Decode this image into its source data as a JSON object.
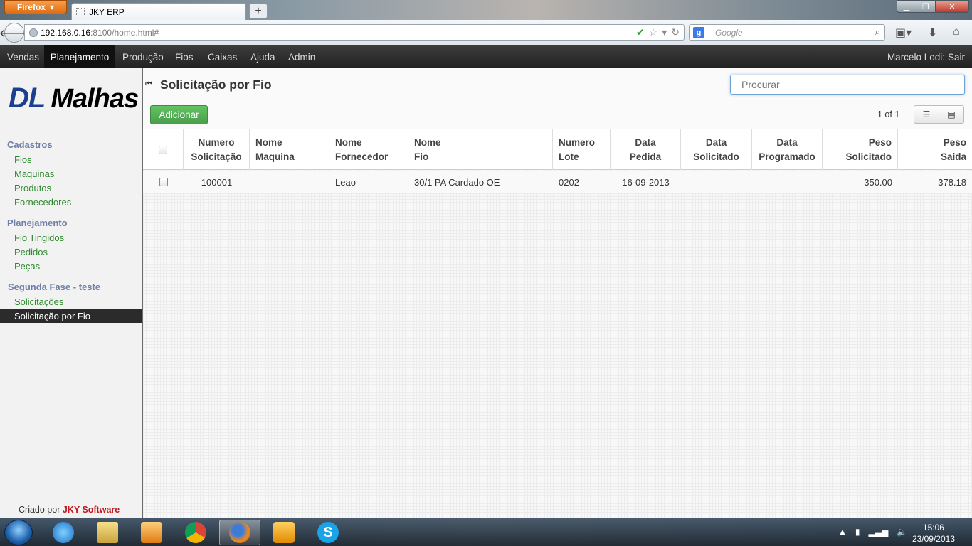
{
  "browser": {
    "menu_button": "Firefox",
    "tab_title": "JKY ERP",
    "url_host": "192.168.0.16",
    "url_rest": ":8100/home.html#",
    "search_placeholder": "Google"
  },
  "app": {
    "menus": [
      "Vendas",
      "Planejamento",
      "Produção",
      "Fios",
      "Caixas",
      "Ajuda",
      "Admin"
    ],
    "active_menu": "Planejamento",
    "user": "Marcelo Lodi:",
    "logout": "Sair"
  },
  "sidebar": {
    "logo_dl": "DL",
    "logo_name": "Malhas",
    "groups": [
      {
        "title": "Cadastros",
        "items": [
          "Fios",
          "Maquinas",
          "Produtos",
          "Fornecedores"
        ]
      },
      {
        "title": "Planejamento",
        "items": [
          "Fio Tingidos",
          "Pedidos",
          "Peças"
        ]
      },
      {
        "title": "Segunda Fase - teste",
        "items": [
          "Solicitações",
          "Solicitação por Fio"
        ]
      }
    ],
    "selected": "Solicitação por Fio",
    "credit_prefix": "Criado por",
    "credit_brand": "JKY Software"
  },
  "main": {
    "title": "Solicitação por Fio",
    "search_placeholder": "Procurar",
    "add_label": "Adicionar",
    "pager": "1 of 1",
    "columns": [
      {
        "l1": "Numero",
        "l2": "Solicitação"
      },
      {
        "l1": "Nome",
        "l2": "Maquina"
      },
      {
        "l1": "Nome",
        "l2": "Fornecedor"
      },
      {
        "l1": "Nome",
        "l2": "Fio"
      },
      {
        "l1": "Numero",
        "l2": "Lote"
      },
      {
        "l1": "Data",
        "l2": "Pedida"
      },
      {
        "l1": "Data",
        "l2": "Solicitado"
      },
      {
        "l1": "Data",
        "l2": "Programado"
      },
      {
        "l1": "Peso",
        "l2": "Solicitado"
      },
      {
        "l1": "Peso",
        "l2": "Saida"
      }
    ],
    "rows": [
      [
        "100001",
        "",
        "Leao",
        "30/1 PA Cardado OE",
        "0202",
        "16-09-2013",
        "",
        "",
        "350.00",
        "378.18"
      ]
    ]
  },
  "taskbar": {
    "time": "15:06",
    "date": "23/09/2013"
  }
}
